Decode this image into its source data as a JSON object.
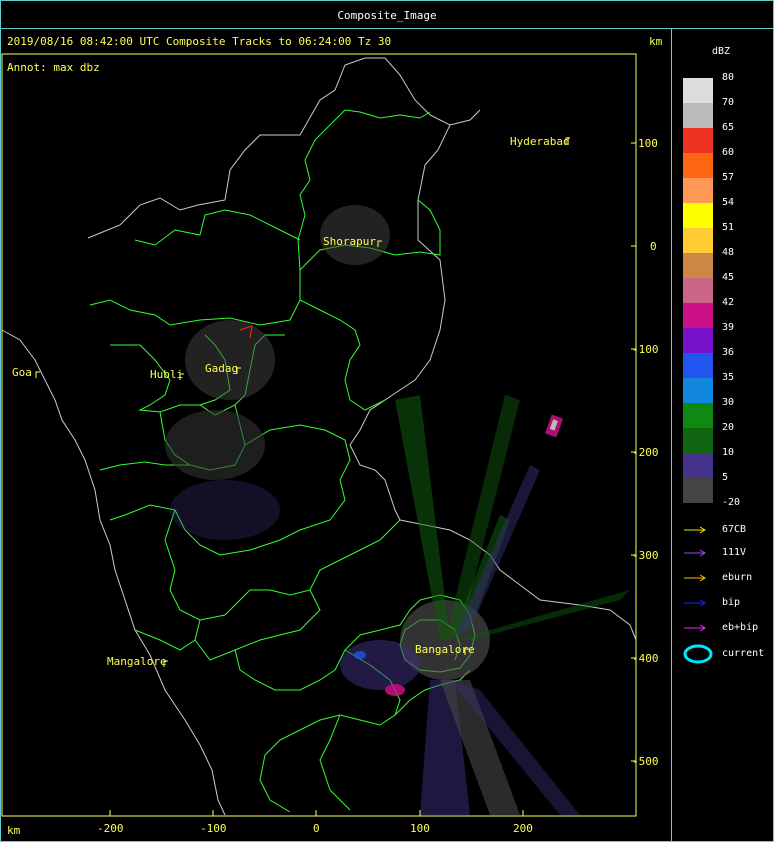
{
  "window": {
    "title": "Composite_Image"
  },
  "header": {
    "timestamp": "2019/08/16 08:42:00 UTC Composite Tracks to 06:24:00 Tz 30",
    "annotation": "Annot: max dbz",
    "unit_top_right": "km",
    "unit_bottom_left": "km"
  },
  "axes": {
    "x_ticks": [
      "-200",
      "-100",
      "0",
      "100",
      "200"
    ],
    "y_ticks": [
      "100",
      "0",
      "-100",
      "-200",
      "-300",
      "-400",
      "-500"
    ]
  },
  "cities": [
    "Hyderabad",
    "Shorapur",
    "Goa",
    "Hubli",
    "Gadag",
    "Mangalore",
    "Bangalore"
  ],
  "scale": {
    "title": "dBZ",
    "labels": [
      "80",
      "70",
      "65",
      "60",
      "57",
      "54",
      "51",
      "48",
      "45",
      "42",
      "39",
      "36",
      "35",
      "30",
      "20",
      "10",
      "5",
      "-20"
    ],
    "colors": [
      "#dddddd",
      "#bbbbbb",
      "#ee3322",
      "#ff6611",
      "#ff9955",
      "#ffff00",
      "#ffcc33",
      "#cc8844",
      "#cc6688",
      "#cc1188",
      "#7711cc",
      "#2255ee",
      "#1188dd",
      "#118811",
      "#116611",
      "#443388",
      "#444444"
    ]
  },
  "tracks_legend": [
    {
      "label": "67CB",
      "color": "#ffdd00"
    },
    {
      "label": "111V",
      "color": "#aa44ff"
    },
    {
      "label": "eburn",
      "color": "#ffbb00"
    },
    {
      "label": "bip",
      "color": "#2222ff"
    },
    {
      "label": "eb+bip",
      "color": "#ff22ff"
    },
    {
      "label": "current",
      "color": "#00e5ff"
    }
  ]
}
